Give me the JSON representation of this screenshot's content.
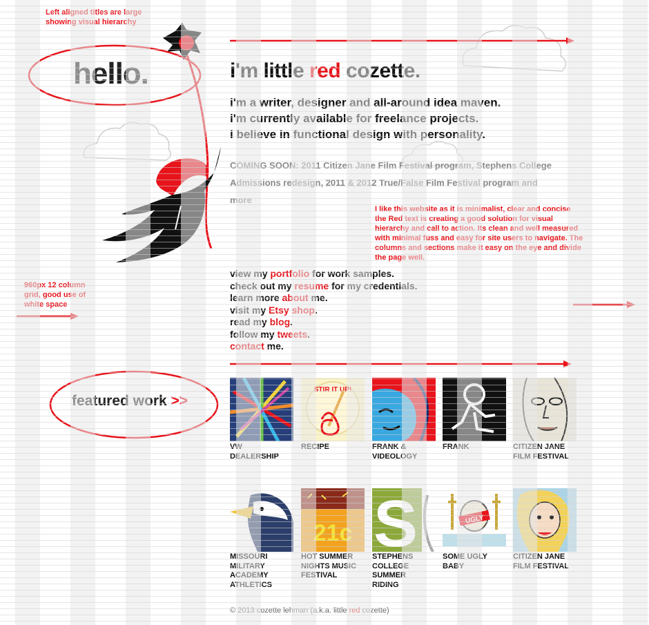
{
  "annotations": {
    "hierarchy_note": [
      "Left aligned titles are large",
      "showing visual hierarchy"
    ],
    "grid_note": [
      "960px 12 column",
      "grid, good use of",
      "white space"
    ],
    "critique": [
      "I like this website as it is minimalist, clear and concise",
      "the Red text is creating a good solution for visual",
      "hierarchy and call to action. Its clean and well measured",
      "with minimal fuss and easy for site users to navigate. The",
      "columns and sections make it easy on the eye and divide",
      "the page well."
    ]
  },
  "header": {
    "hello": "hello.",
    "title_before": "i'm little ",
    "title_red": "red",
    "title_after": " cozette."
  },
  "intro_lines": [
    "i'm a writer, designer and all-around idea maven.",
    "i'm currently available for freelance projects.",
    "i believe in functional design with personality."
  ],
  "coming_soon": "COMING SOON: 2011 Citizen Jane Film Festival program, Stephens College Admissions redesign, 2011 & 2012 True/False Film Festival program and more",
  "links": [
    {
      "before": "view my ",
      "link": "portfolio",
      "after": " for work samples."
    },
    {
      "before": "check out my ",
      "link": "resume",
      "after": " for my credentials."
    },
    {
      "before": "learn more ",
      "link": "about",
      "after": " me."
    },
    {
      "before": "visit my ",
      "link": "Etsy shop",
      "after": "."
    },
    {
      "before": "read my ",
      "link": "blog",
      "after": "."
    },
    {
      "before": "follow my ",
      "link": "tweets",
      "after": "."
    },
    {
      "before": "",
      "link": "contact",
      "after": " me."
    }
  ],
  "featured": {
    "label": "featured work ",
    "arrows": ">>"
  },
  "work_row1": [
    {
      "caption": [
        "VW",
        "DEALERSHIP"
      ],
      "icon": "colorful-ribbons-thumbnail"
    },
    {
      "caption": [
        "RECIPE"
      ],
      "icon": "stir-it-up-thumbnail",
      "badge": "STIR IT UP!"
    },
    {
      "caption": [
        "FRANK &",
        "VIDEOLOGY"
      ],
      "icon": "blue-face-thumbnail"
    },
    {
      "caption": [
        "FRANK"
      ],
      "icon": "stick-figure-thumbnail"
    },
    {
      "caption": [
        "CITIZEN JANE",
        "FILM FESTIVAL"
      ],
      "icon": "sketch-face-thumbnail"
    }
  ],
  "work_row2": [
    {
      "caption": [
        "MISSOURI",
        "MILITARY",
        "ACADEMY",
        "ATHLETICS"
      ],
      "icon": "eagle-thumbnail"
    },
    {
      "caption": [
        "HOT SUMMER",
        "NIGHTS MUSIC",
        "FESTIVAL"
      ],
      "icon": "21-poster-thumbnail",
      "badge": "21c"
    },
    {
      "caption": [
        "STEPHENS",
        "COLLEGE",
        "SUMMER",
        "RIDING"
      ],
      "icon": "letter-s-thumbnail",
      "badge": "S"
    },
    {
      "caption": [
        "SOME UGLY",
        "BABY"
      ],
      "icon": "ugly-baby-thumbnail",
      "badge": "UGLY"
    },
    {
      "caption": [
        "CITIZEN JANE",
        "FILM FESTIVAL"
      ],
      "icon": "retro-woman-thumbnail"
    }
  ],
  "footer": {
    "before": "© 2013 cozette lehman (a.k.a. little ",
    "red": "red",
    "after": " cozette)"
  },
  "colors": {
    "accent": "#e8141b",
    "text": "#111111",
    "muted": "#8a8a8a"
  }
}
